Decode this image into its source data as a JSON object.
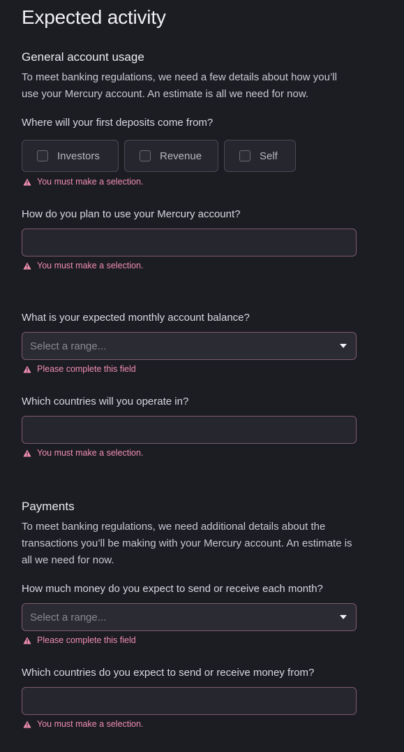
{
  "page_title": "Expected activity",
  "general": {
    "title": "General account usage",
    "description": "To meet banking regulations, we need a few details about how you’ll use your Mercury account. An estimate is all we need for now.",
    "deposits": {
      "question": "Where will your first deposits come from?",
      "options": [
        {
          "label": "Investors",
          "checked": false
        },
        {
          "label": "Revenue",
          "checked": false
        },
        {
          "label": "Self",
          "checked": false
        }
      ],
      "error": "You must make a selection."
    },
    "usage": {
      "question": "How do you plan to use your Mercury account?",
      "value": "",
      "error": "You must make a selection."
    },
    "balance": {
      "question": "What is your expected monthly account balance?",
      "placeholder": "Select a range...",
      "error": "Please complete this field"
    },
    "countries": {
      "question": "Which countries will you operate in?",
      "value": "",
      "error": "You must make a selection."
    }
  },
  "payments": {
    "title": "Payments",
    "description": "To meet banking regulations, we need additional details about the transactions you’ll be making with your Mercury account. An estimate is all we need for now.",
    "monthly_amount": {
      "question": "How much money do you expect to send or receive each month?",
      "placeholder": "Select a range...",
      "error": "Please complete this field"
    },
    "countries": {
      "question": "Which countries do you expect to send or receive money from?",
      "value": "",
      "error": "You must make a selection."
    }
  },
  "colors": {
    "background": "#1c1c23",
    "error": "#f08fb0",
    "error_border": "#7e5b6c"
  }
}
